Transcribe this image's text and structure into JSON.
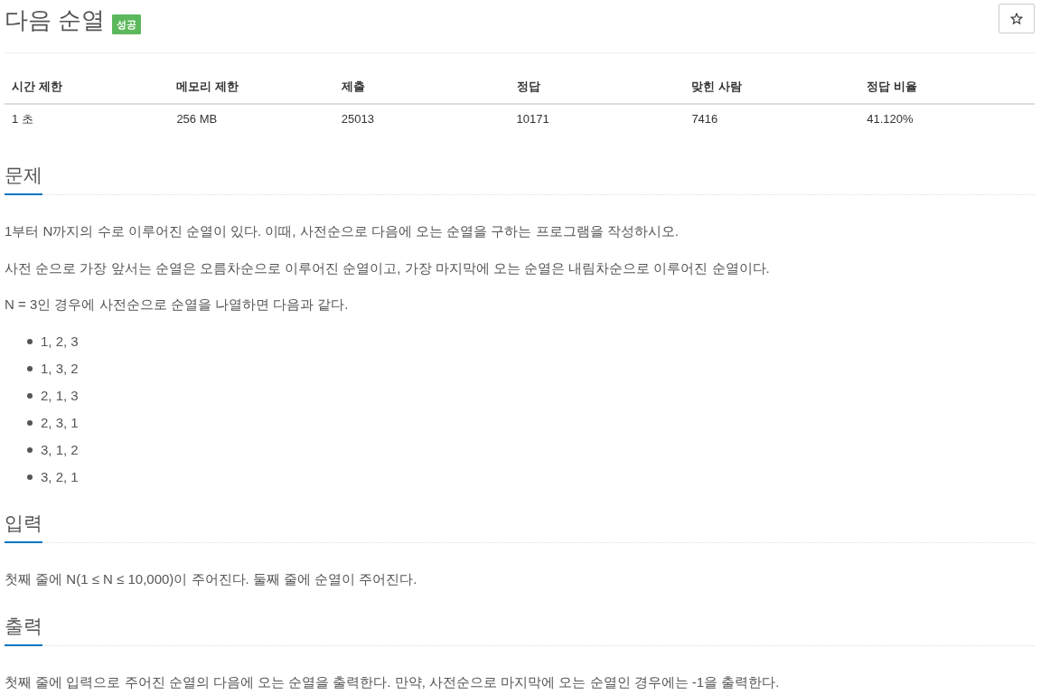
{
  "problem": {
    "title": "다음 순열",
    "status_badge": {
      "label": "성공",
      "kind": "success"
    },
    "favorite_button": {
      "starred": false
    }
  },
  "info_table": {
    "columns": [
      "시간 제한",
      "메모리 제한",
      "제출",
      "정답",
      "맞힌 사람",
      "정답 비율"
    ],
    "rows": [
      [
        "1 초",
        "256 MB",
        "25013",
        "10171",
        "7416",
        "41.120%"
      ]
    ]
  },
  "sections": [
    {
      "heading": "문제",
      "paragraphs": [
        "1부터 N까지의 수로 이루어진 순열이 있다. 이때, 사전순으로 다음에 오는 순열을 구하는 프로그램을 작성하시오.",
        "사전 순으로 가장 앞서는 순열은 오름차순으로 이루어진 순열이고, 가장 마지막에 오는 순열은 내림차순으로 이루어진 순열이다.",
        "N = 3인 경우에 사전순으로 순열을 나열하면 다음과 같다."
      ],
      "list_items": [
        "1, 2, 3",
        "1, 3, 2",
        "2, 1, 3",
        "2, 3, 1",
        "3, 1, 2",
        "3, 2, 1"
      ]
    },
    {
      "heading": "입력",
      "paragraphs": [
        "첫째 줄에 N(1 ≤ N ≤ 10,000)이 주어진다. 둘째 줄에 순열이 주어진다."
      ]
    },
    {
      "heading": "출력",
      "paragraphs": [
        "첫째 줄에 입력으로 주어진 순열의 다음에 오는 순열을 출력한다. 만약, 사전순으로 마지막에 오는 순열인 경우에는 -1을 출력한다."
      ]
    }
  ]
}
